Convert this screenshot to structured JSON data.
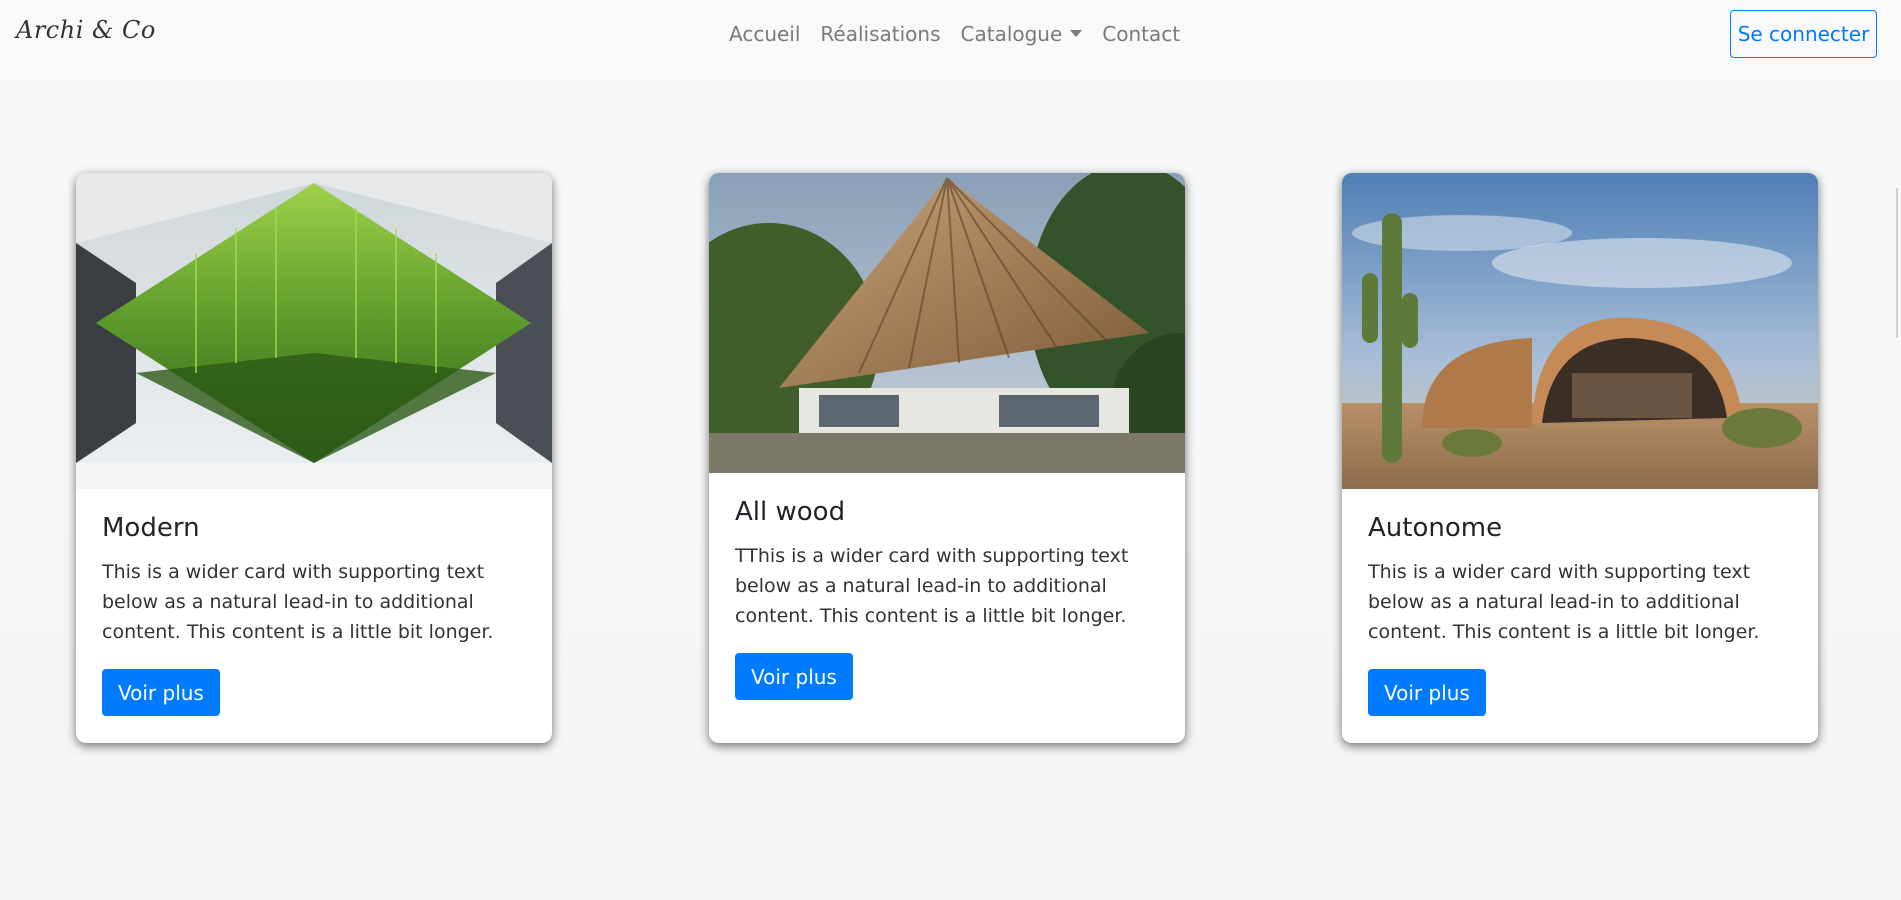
{
  "navbar": {
    "brand": "Archi & Co",
    "links": [
      "Accueil",
      "Réalisations",
      "Catalogue",
      "Contact"
    ],
    "login": "Se connecter"
  },
  "cards": [
    {
      "title": "Modern",
      "text": "This is a wider card with supporting text below as a natural lead-in to additional content. This content is a little bit longer.",
      "button": "Voir plus",
      "image": "green-hanging-garden-photo"
    },
    {
      "title": "All wood",
      "text": "TThis is a wider card with supporting text below as a natural lead-in to additional content. This content is a little bit longer.",
      "button": "Voir plus",
      "image": "wooden-triangular-house-photo"
    },
    {
      "title": "Autonome",
      "text": "This is a wider card with supporting text below as a natural lead-in to additional content. This content is a little bit longer.",
      "button": "Voir plus",
      "image": "desert-dome-house-photo"
    }
  ],
  "colors": {
    "primary": "#007bff",
    "navbar_bg": "#f8f9fa"
  }
}
